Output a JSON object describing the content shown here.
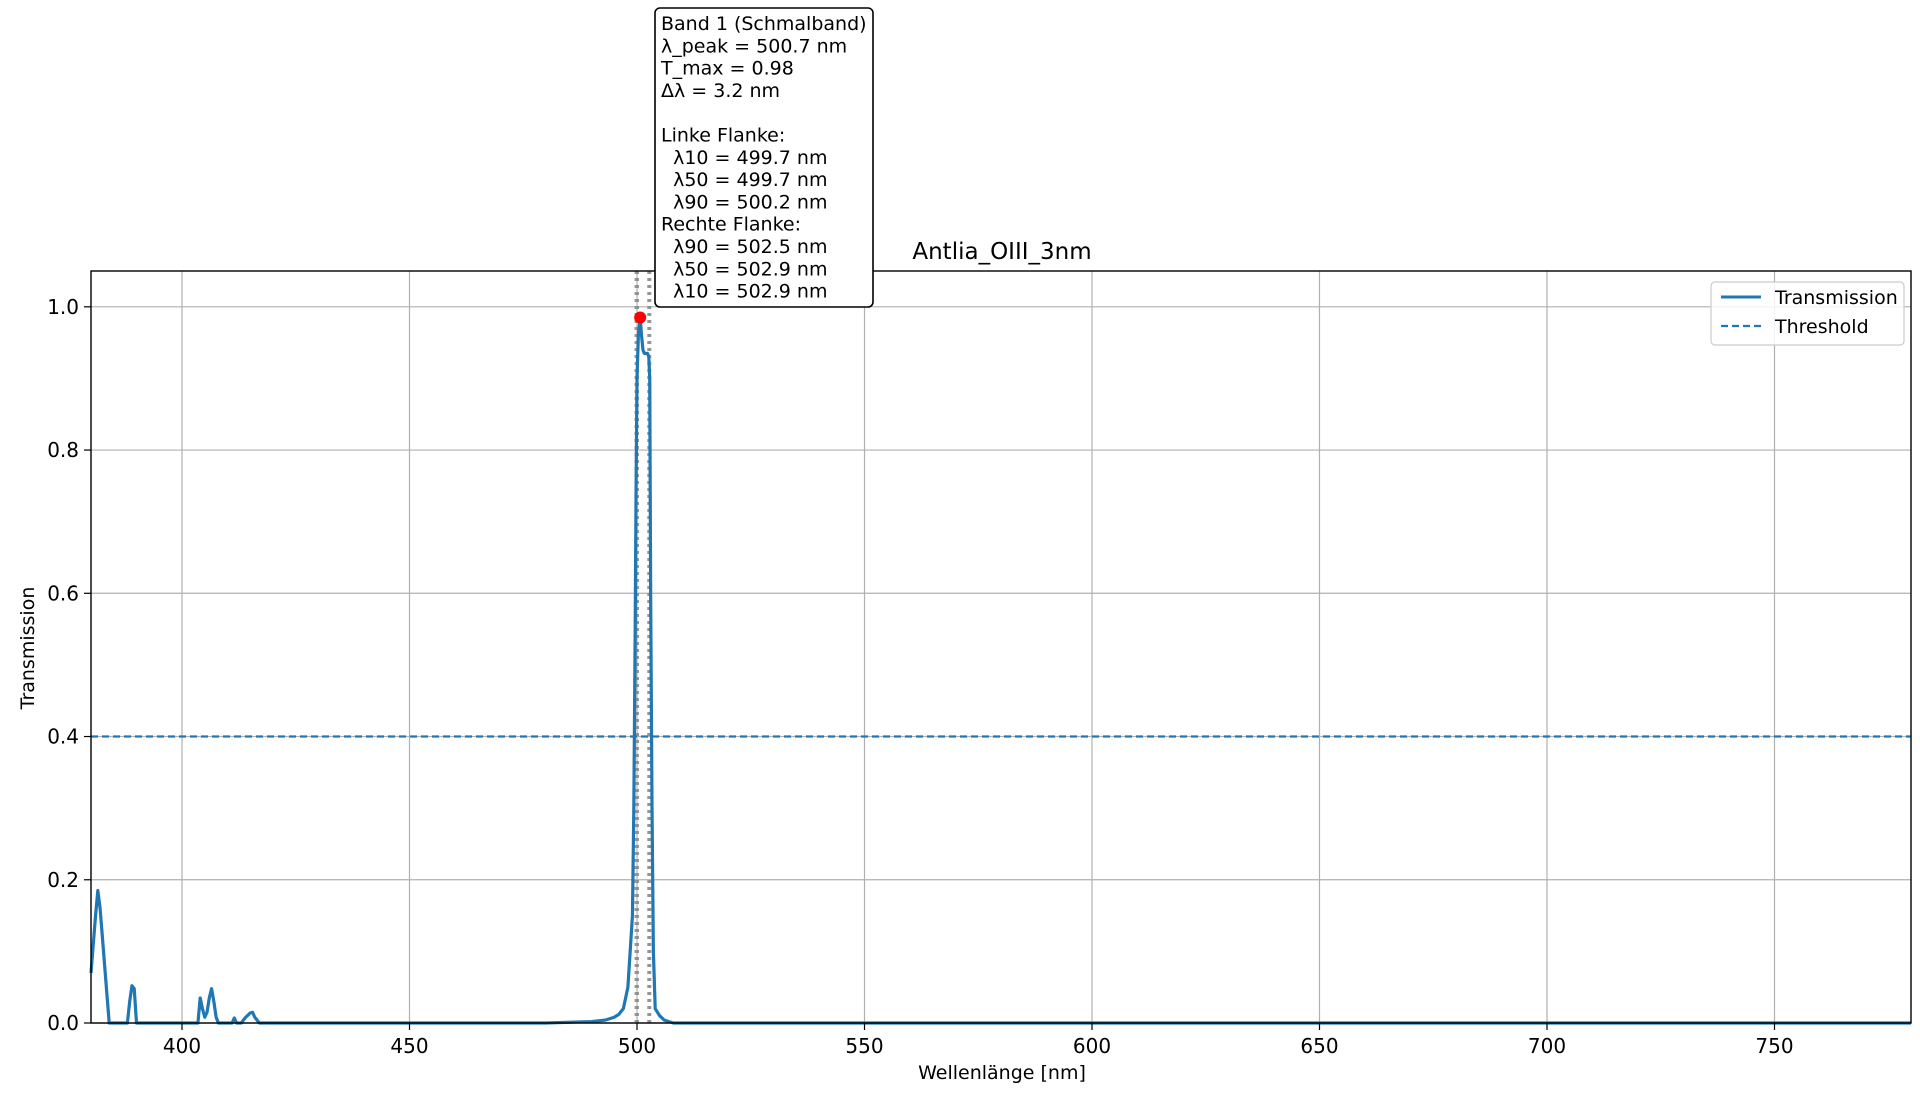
{
  "chart_data": {
    "type": "line",
    "title": "Antlia_OIII_3nm",
    "xlabel": "Wellenlänge [nm]",
    "ylabel": "Transmission",
    "xlim": [
      380,
      780
    ],
    "ylim": [
      0,
      1.05
    ],
    "xticks": [
      400,
      450,
      500,
      550,
      600,
      650,
      700,
      750
    ],
    "yticks": [
      0.0,
      0.2,
      0.4,
      0.6,
      0.8,
      1.0
    ],
    "grid": true,
    "legend_placement": "top-right",
    "colors": {
      "transmission": "#1f77b4",
      "threshold": "#1f77b4",
      "peak_marker": "#ff0000",
      "flank_lines": "#7f7f7f",
      "grid": "#b0b0b0"
    },
    "series": [
      {
        "name": "Transmission",
        "style": "solid",
        "x": [
          380,
          381,
          381.5,
          382,
          382.5,
          383,
          383.5,
          384,
          385,
          386,
          387,
          388,
          388.5,
          389,
          389.5,
          390,
          391,
          395,
          400,
          403.5,
          404,
          404.5,
          405,
          405.5,
          406,
          406.5,
          407,
          407.5,
          408,
          409,
          410,
          411,
          411.5,
          412,
          413,
          414,
          415,
          415.5,
          416,
          417,
          418,
          420,
          430,
          450,
          480,
          490,
          493,
          495,
          496,
          497,
          498,
          499,
          499.3,
          499.6,
          499.8,
          500,
          500.3,
          500.7,
          501,
          501.3,
          501.6,
          502,
          502.3,
          502.6,
          502.8,
          503,
          503.3,
          503.6,
          504,
          504.5,
          505,
          506,
          508,
          510,
          520,
          550,
          600,
          650,
          700,
          750,
          780
        ],
        "y": [
          0.07,
          0.15,
          0.185,
          0.16,
          0.12,
          0.08,
          0.04,
          0.0,
          0.0,
          0.0,
          0.0,
          0.0,
          0.03,
          0.052,
          0.048,
          0.0,
          0.0,
          0.0,
          0.0,
          0.0,
          0.035,
          0.02,
          0.008,
          0.015,
          0.035,
          0.048,
          0.03,
          0.008,
          0.0,
          0.0,
          0.0,
          0.0,
          0.007,
          0.0,
          0.0,
          0.008,
          0.014,
          0.015,
          0.008,
          0.0,
          0.0,
          0.0,
          0.0,
          0.0,
          0.0,
          0.002,
          0.004,
          0.008,
          0.012,
          0.02,
          0.05,
          0.15,
          0.3,
          0.55,
          0.75,
          0.9,
          0.96,
          0.985,
          0.96,
          0.94,
          0.935,
          0.935,
          0.935,
          0.93,
          0.9,
          0.6,
          0.3,
          0.1,
          0.02,
          0.015,
          0.01,
          0.004,
          0.0,
          0.0,
          0.0,
          0.0,
          0.0,
          0.0,
          0.0,
          0.0,
          0.0
        ]
      },
      {
        "name": "Threshold",
        "style": "dashed",
        "x": [
          380,
          780
        ],
        "y": [
          0.4,
          0.4
        ]
      }
    ],
    "peak": {
      "x": 500.7,
      "y": 0.985
    },
    "flank_lines_x": [
      499.7,
      500.2,
      502.5,
      502.9
    ],
    "annotation_lines": [
      "Band 1 (Schmalband)",
      "λ_peak = 500.7 nm",
      "T_max = 0.98",
      "Δλ = 3.2 nm",
      "",
      "Linke Flanke:",
      "  λ10 = 499.7 nm",
      "  λ50 = 499.7 nm",
      "  λ90 = 500.2 nm",
      "Rechte Flanke:",
      "  λ90 = 502.5 nm",
      "  λ50 = 502.9 nm",
      "  λ10 = 502.9 nm"
    ]
  }
}
